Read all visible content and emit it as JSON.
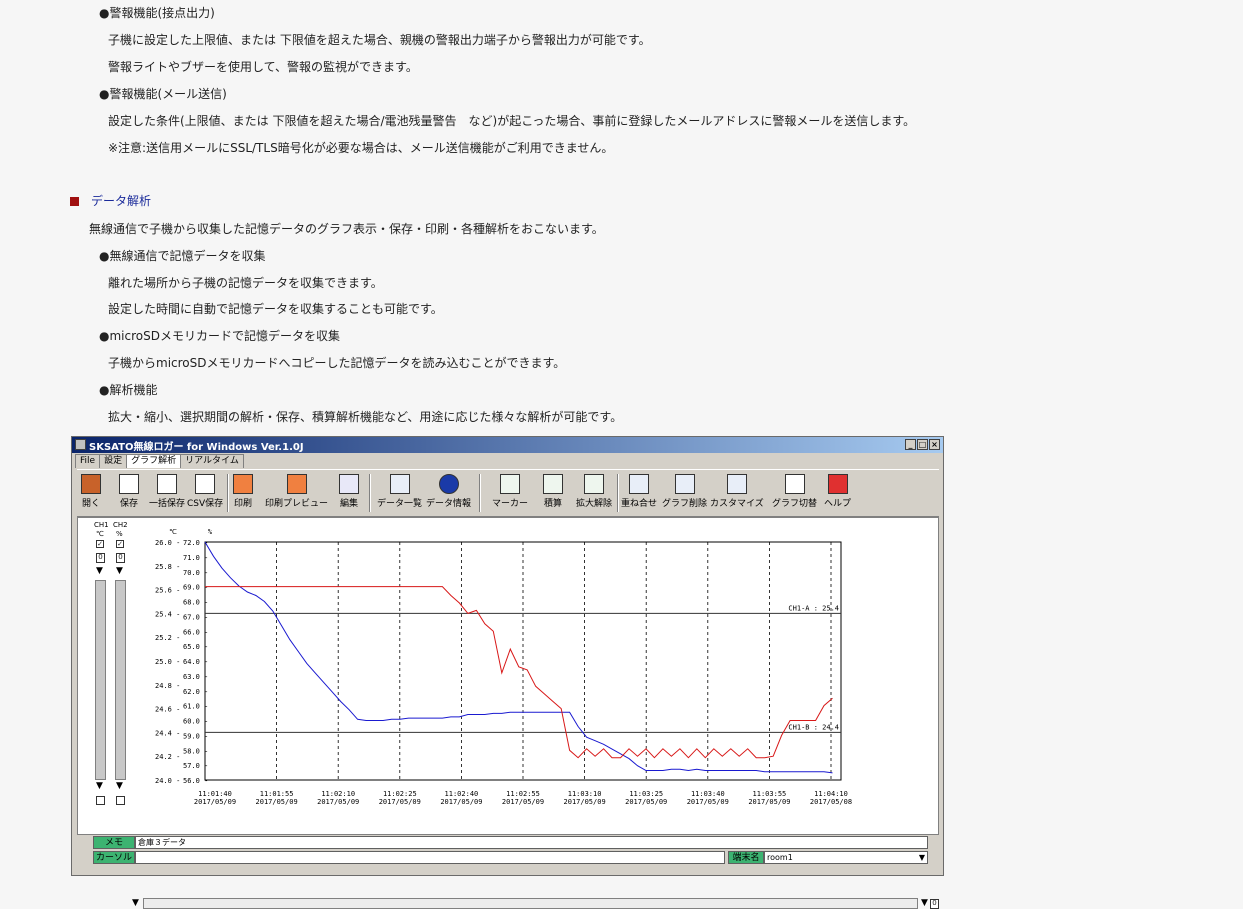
{
  "text": {
    "alarm_contact_title": "警報機能(接点出力)",
    "alarm_contact_desc1": "子機に設定した上限値、または 下限値を超えた場合、親機の警報出力端子から警報出力が可能です。",
    "alarm_contact_desc2": "警報ライトやブザーを使用して、警報の監視ができます。",
    "alarm_mail_title": "警報機能(メール送信)",
    "alarm_mail_desc1": "設定した条件(上限値、または 下限値を超えた場合/電池残量警告　など)が起こった場合、事前に登録したメールアドレスに警報メールを送信します。",
    "alarm_mail_note": "※注意:送信用メールにSSL/TLS暗号化が必要な場合は、メール送信機能がご利用できません。",
    "section_title": "データ解析",
    "section_intro": "無線通信で子機から収集した記憶データのグラフ表示・保存・印刷・各種解析をおこないます。",
    "wireless_title": "無線通信で記憶データを収集",
    "wireless_desc1": "離れた場所から子機の記憶データを収集できます。",
    "wireless_desc2": "設定した時間に自動で記憶データを収集することも可能です。",
    "sd_title": "microSDメモリカードで記憶データを収集",
    "sd_desc": "子機からmicroSDメモリカードへコピーした記憶データを読み込むことができます。",
    "analysis_title": "解析機能",
    "analysis_desc": "拡大・縮小、選択期間の解析・保存、積算解析機能など、用途に応じた様々な解析が可能です。"
  },
  "app": {
    "title": "SKSATO無線ロガー for Windows Ver.1.0J",
    "tabs": [
      "File",
      "設定",
      "グラフ解析",
      "リアルタイム"
    ],
    "toolbar": [
      "開く",
      "保存",
      "一括保存",
      "CSV保存",
      "印刷",
      "印刷プレビュー",
      "編集",
      "データ一覧",
      "データ情報",
      "マーカー",
      "積算",
      "拡大解除",
      "重ね合せ",
      "グラフ削除",
      "カスタマイズ",
      "グラフ切替",
      "ヘルプ"
    ],
    "ch1_label": "CH1",
    "ch1_unit": "℃",
    "ch2_label": "CH2",
    "ch2_unit": "%",
    "ch_value": "0",
    "zoom_value": "0",
    "memo_label": "メモ",
    "memo_value": "倉庫３データ",
    "cursor_label": "カーソル",
    "cursor_value": "",
    "terminal_label": "端末名",
    "terminal_value": "room1",
    "colors": {
      "ch1": "#1a1ad0",
      "ch2": "#d81818"
    }
  },
  "chart_data": {
    "type": "line",
    "y_left_unit": "℃",
    "y_right_unit": "%",
    "y_left_ticks": [
      "26.0",
      "25.8",
      "25.6",
      "25.4",
      "25.2",
      "25.0",
      "24.8",
      "24.6",
      "24.4",
      "24.2",
      "24.0"
    ],
    "y_right_ticks": [
      "72.0",
      "71.0",
      "70.0",
      "69.0",
      "68.0",
      "67.0",
      "66.0",
      "65.0",
      "64.0",
      "63.0",
      "62.0",
      "61.0",
      "60.0",
      "59.0",
      "58.0",
      "57.0",
      "56.0"
    ],
    "x_ticks": [
      {
        "time": "11:01:40",
        "date": "2017/05/09"
      },
      {
        "time": "11:01:55",
        "date": "2017/05/09"
      },
      {
        "time": "11:02:10",
        "date": "2017/05/09"
      },
      {
        "time": "11:02:25",
        "date": "2017/05/09"
      },
      {
        "time": "11:02:40",
        "date": "2017/05/09"
      },
      {
        "time": "11:02:55",
        "date": "2017/05/09"
      },
      {
        "time": "11:03:10",
        "date": "2017/05/09"
      },
      {
        "time": "11:03:25",
        "date": "2017/05/09"
      },
      {
        "time": "11:03:40",
        "date": "2017/05/09"
      },
      {
        "time": "11:03:55",
        "date": "2017/05/09"
      },
      {
        "time": "11:04:10",
        "date": "2017/05/08"
      }
    ],
    "ylim_left": [
      24.0,
      26.0
    ],
    "ylim_right": [
      56.0,
      72.0
    ],
    "alarm_lines": [
      {
        "label": "CH1-A : 25.4",
        "value": 25.4
      },
      {
        "label": "CH1-B : 24.4",
        "value": 24.4
      }
    ],
    "series": [
      {
        "name": "CH1",
        "axis": "left",
        "x": [
          0,
          2,
          4,
          6,
          8,
          10,
          12,
          14,
          16,
          18,
          20,
          22,
          24,
          26,
          28,
          30,
          32,
          34,
          36,
          38,
          40,
          42,
          44,
          46,
          48,
          50,
          52,
          54,
          56,
          58,
          60,
          62,
          64,
          66,
          68,
          70,
          72,
          74,
          76,
          78,
          80,
          82,
          84,
          86,
          88,
          90,
          92,
          94,
          96,
          98,
          100,
          102,
          104,
          106,
          108,
          110,
          112,
          114,
          116,
          118,
          120,
          122,
          124,
          126,
          128,
          130,
          132,
          134,
          136,
          138,
          140,
          142,
          144,
          146,
          148
        ],
        "y": [
          26.0,
          25.88,
          25.78,
          25.7,
          25.63,
          25.58,
          25.55,
          25.5,
          25.42,
          25.3,
          25.18,
          25.08,
          24.98,
          24.9,
          24.82,
          24.74,
          24.66,
          24.59,
          24.51,
          24.5,
          24.5,
          24.5,
          24.51,
          24.51,
          24.52,
          24.52,
          24.52,
          24.52,
          24.52,
          24.53,
          24.53,
          24.55,
          24.55,
          24.55,
          24.56,
          24.56,
          24.57,
          24.57,
          24.57,
          24.57,
          24.57,
          24.57,
          24.57,
          24.57,
          24.45,
          24.36,
          24.33,
          24.3,
          24.26,
          24.22,
          24.18,
          24.12,
          24.08,
          24.08,
          24.08,
          24.09,
          24.09,
          24.08,
          24.09,
          24.08,
          24.08,
          24.08,
          24.08,
          24.08,
          24.08,
          24.08,
          24.07,
          24.07,
          24.07,
          24.07,
          24.07,
          24.07,
          24.07,
          24.07,
          24.06
        ]
      },
      {
        "name": "CH2",
        "axis": "right",
        "x": [
          0,
          10,
          20,
          30,
          40,
          50,
          56,
          58,
          60,
          62,
          64,
          66,
          68,
          70,
          72,
          74,
          76,
          78,
          80,
          82,
          84,
          86,
          88,
          90,
          92,
          94,
          96,
          98,
          100,
          102,
          104,
          106,
          108,
          110,
          112,
          114,
          116,
          118,
          120,
          122,
          124,
          126,
          128,
          130,
          132,
          134,
          136,
          138,
          140,
          142,
          144,
          146,
          148
        ],
        "y": [
          69.0,
          69.0,
          69.0,
          69.0,
          69.0,
          69.0,
          69.0,
          68.4,
          67.9,
          67.2,
          67.4,
          66.5,
          66.0,
          63.2,
          64.8,
          63.6,
          63.4,
          62.3,
          61.8,
          61.3,
          60.8,
          58.0,
          57.5,
          58.1,
          57.6,
          58.1,
          57.5,
          57.5,
          58.1,
          57.6,
          58.1,
          57.5,
          58.1,
          57.6,
          58.1,
          57.5,
          58.1,
          57.5,
          58.1,
          57.6,
          58.1,
          57.6,
          58.1,
          57.5,
          57.5,
          57.6,
          59.0,
          60.0,
          60.0,
          60.0,
          60.0,
          61.0,
          61.5
        ]
      }
    ]
  }
}
